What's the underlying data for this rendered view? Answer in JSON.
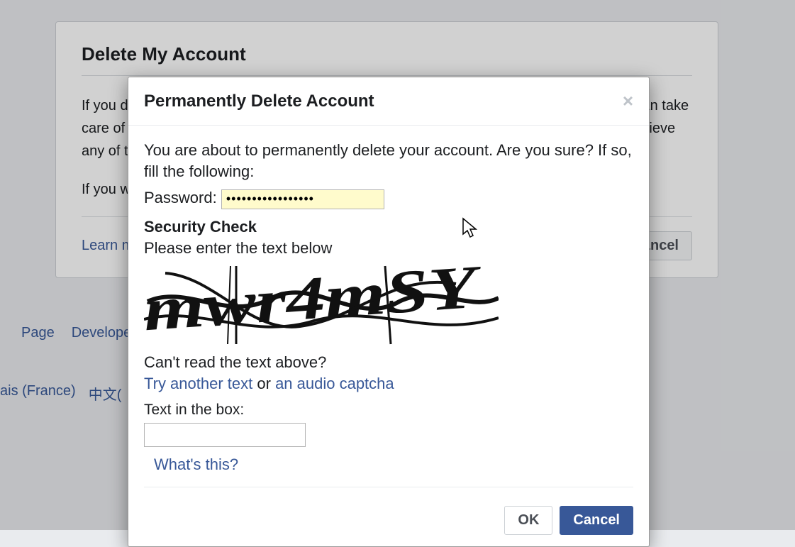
{
  "background": {
    "title": "Delete My Account",
    "p1": "If you do not think you will use Facebook again and would like your account deleted, we can take care of this for you. Keep in mind that you will not be able to reactivate your account or retrieve any of the content or information you have added.",
    "p2": "If you would still like your account deleted, click \"Delete My Account.\"",
    "learn_more": "Learn more",
    "cancel": "Cancel"
  },
  "footer": {
    "page_link": "Page",
    "developers_link": "Developers",
    "lang_fr": "ais (France)",
    "lang_zh": "中文("
  },
  "dialog": {
    "title": "Permanently Delete Account",
    "confirm_line": "You are about to permanently delete your account. Are you sure? If so, fill the following:",
    "password_label": "Password:",
    "password_mask": "•••••••••••••••••",
    "security_heading": "Security Check",
    "security_instruction": "Please enter the text below",
    "captcha_rendered_text": "mwr4mSY",
    "cant_read": "Can't read the text above?",
    "try_another": "Try another text",
    "or_word": "or",
    "audio_captcha": "an audio captcha",
    "text_in_box_label": "Text in the box:",
    "whats_this": "What's this?",
    "ok": "OK",
    "cancel": "Cancel"
  }
}
